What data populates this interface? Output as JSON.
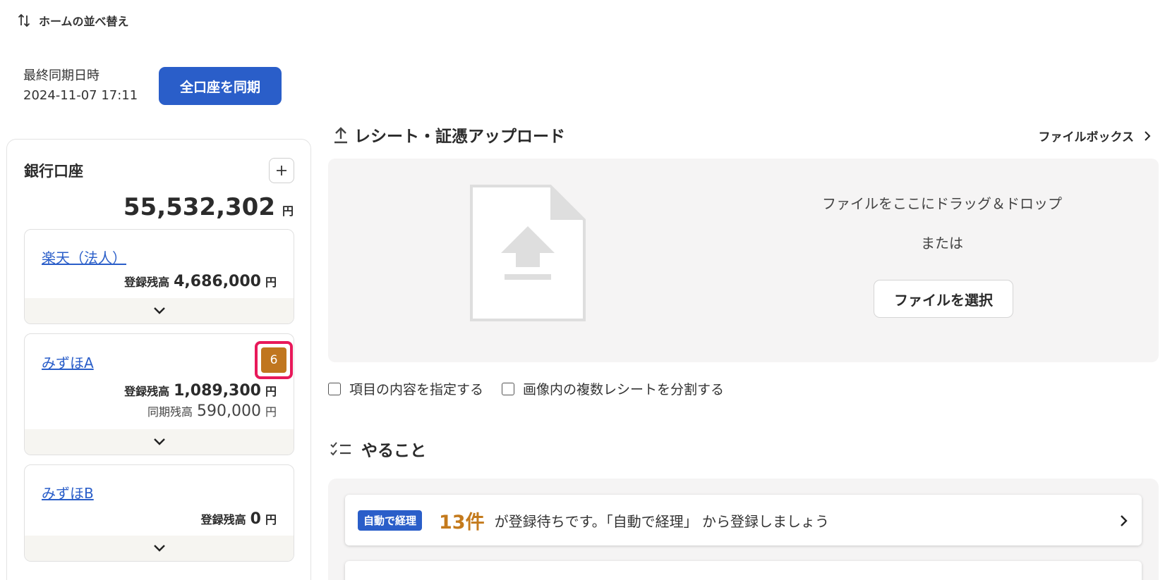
{
  "header": {
    "sort_label": "ホームの並べ替え"
  },
  "sync": {
    "label": "最終同期日時",
    "datetime": "2024-11-07 17:11",
    "button": "全口座を同期"
  },
  "bank_panel": {
    "title": "銀行口座",
    "total": "55,532,302",
    "currency": "円",
    "accounts": [
      {
        "name": "楽天（法人）",
        "registered_label": "登録残高",
        "registered_value": "4,686,000",
        "currency": "円"
      },
      {
        "name": "みずほA",
        "badge": "6",
        "registered_label": "登録残高",
        "registered_value": "1,089,300",
        "currency": "円",
        "synced_label": "同期残高",
        "synced_value": "590,000"
      },
      {
        "name": "みずほB",
        "registered_label": "登録残高",
        "registered_value": "0",
        "currency": "円"
      }
    ]
  },
  "upload": {
    "title": "レシート・証憑アップロード",
    "filebox_link": "ファイルボックス",
    "drop_text": "ファイルをここにドラッグ＆ドロップ",
    "or_text": "または",
    "select_button": "ファイルを選択",
    "options": [
      "項目の内容を指定する",
      "画像内の複数レシートを分割する"
    ]
  },
  "todo": {
    "title": "やること",
    "items": [
      {
        "tag": "自動で経理",
        "count": "13件",
        "text": "が登録待ちです。「自動で経理」 から登録しましょう"
      }
    ]
  },
  "colors": {
    "accent": "#2a5ec9",
    "badge": "#c0761f",
    "badge_highlight": "#e8195a",
    "count": "#c47a1c",
    "panel_bg": "#f5f4f4"
  }
}
